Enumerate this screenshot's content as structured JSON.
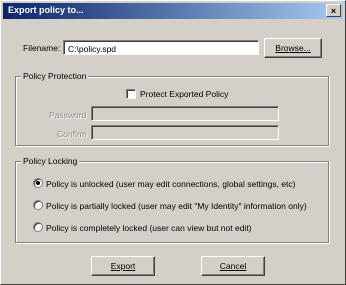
{
  "dialog": {
    "title": "Export policy to...",
    "close_glyph": "×"
  },
  "filename": {
    "label": "Filename:",
    "value": "C:\\policy.spd",
    "browse_label": "Browse..."
  },
  "protection": {
    "group_title": "Policy Protection",
    "checkbox_label": "Protect Exported Policy",
    "checked": false,
    "password_label": "Password",
    "password_value": "",
    "confirm_label": "Confirm",
    "confirm_value": ""
  },
  "locking": {
    "group_title": "Policy Locking",
    "selected_index": 0,
    "options": [
      {
        "label": "Policy is unlocked (user may edit connections, global settings, etc)"
      },
      {
        "label": "Policy is partially locked (user may edit \"My Identity\" information only)"
      },
      {
        "label": "Policy is completely locked (user can view but not edit)"
      }
    ]
  },
  "buttons": {
    "export_label": "Export",
    "cancel_label": "Cancel"
  }
}
